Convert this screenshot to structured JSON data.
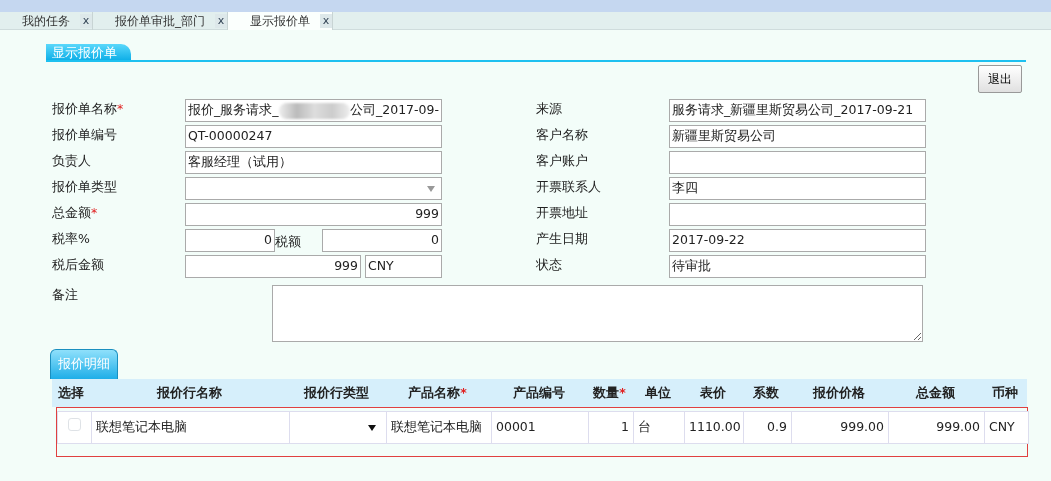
{
  "tabs": [
    {
      "label": "我的任务",
      "close": "x",
      "selected": false
    },
    {
      "label": "报价单审批_部门",
      "close": "x",
      "selected": false
    },
    {
      "label": "显示报价单",
      "close": "x",
      "selected": true
    }
  ],
  "section_title": "显示报价单",
  "exit_button": "退出",
  "left_fields": [
    {
      "kind": "blurred",
      "label": "报价单名称",
      "required_mark": "*",
      "value": "报价_服务请求_",
      "value_end": "公司_2017-09-"
    },
    {
      "kind": "text",
      "label": "报价单编号",
      "value": "QT-00000247"
    },
    {
      "kind": "text",
      "label": "负责人",
      "value": "客服经理（试用）"
    },
    {
      "kind": "select",
      "label": "报价单类型"
    },
    {
      "kind": "number",
      "label": "总金额",
      "required_mark": "*",
      "value": "999"
    },
    {
      "kind": "split",
      "label": "税率%",
      "value": "0",
      "sublabel": "税额",
      "value2": "0"
    },
    {
      "kind": "currency",
      "label": "税后金额",
      "value": "999",
      "unit": "CNY"
    }
  ],
  "right_fields": [
    {
      "label": "来源",
      "value": "服务请求_新疆里斯贸易公司_2017-09-21"
    },
    {
      "label": "客户名称",
      "value": "新疆里斯贸易公司"
    },
    {
      "label": "客户账户"
    },
    {
      "label": "开票联系人",
      "value": "李四"
    },
    {
      "label": "开票地址"
    },
    {
      "label": "产生日期",
      "value": "2017-09-22"
    },
    {
      "label": "状态",
      "value": "待审批"
    }
  ],
  "remark": {
    "label": "备注"
  },
  "detail_tab": "报价明细",
  "table": {
    "columns": [
      {
        "label": "选择"
      },
      {
        "label": "报价行名称"
      },
      {
        "label": "报价行类型"
      },
      {
        "label": "产品名称",
        "required_mark": "*"
      },
      {
        "label": "产品编号"
      },
      {
        "label": "数量",
        "required_mark": "*"
      },
      {
        "label": "单位"
      },
      {
        "label": "表价"
      },
      {
        "label": "系数"
      },
      {
        "label": "报价价格"
      },
      {
        "label": "总金额"
      },
      {
        "label": "币种"
      }
    ],
    "rows": [
      {
        "checked": false,
        "name": "联想笔记本电脑",
        "product": "联想笔记本电脑",
        "code": "00001",
        "qty": "1",
        "unit": "台",
        "list_price": "1110.00",
        "factor": "0.9",
        "price": "999.00",
        "total": "999.00",
        "currency": "CNY"
      }
    ]
  }
}
